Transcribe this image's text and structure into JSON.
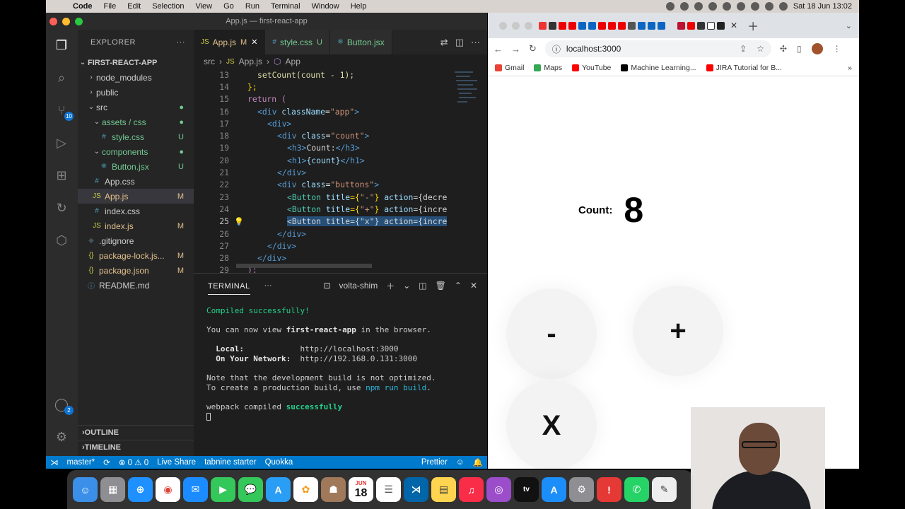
{
  "menubar": {
    "items": [
      "Code",
      "File",
      "Edit",
      "Selection",
      "View",
      "Go",
      "Run",
      "Terminal",
      "Window",
      "Help"
    ],
    "clock": "Sat 18 Jun  13:02"
  },
  "vscode": {
    "window_title": "App.js — first-react-app",
    "explorer": {
      "header": "EXPLORER",
      "project": "FIRST-REACT-APP",
      "items": [
        {
          "label": "node_modules",
          "status": ""
        },
        {
          "label": "public",
          "status": ""
        },
        {
          "label": "src",
          "status": ""
        },
        {
          "label": "assets / css",
          "status": ""
        },
        {
          "label": "style.css",
          "status": "U"
        },
        {
          "label": "components",
          "status": ""
        },
        {
          "label": "Button.jsx",
          "status": "U"
        },
        {
          "label": "App.css",
          "status": ""
        },
        {
          "label": "App.js",
          "status": "M"
        },
        {
          "label": "index.css",
          "status": ""
        },
        {
          "label": "index.js",
          "status": "M"
        },
        {
          "label": ".gitignore",
          "status": ""
        },
        {
          "label": "package-lock.js...",
          "status": "M"
        },
        {
          "label": "package.json",
          "status": "M"
        },
        {
          "label": "README.md",
          "status": ""
        }
      ],
      "outline": "OUTLINE",
      "timeline": "TIMELINE"
    },
    "activity_badges": {
      "scm": "10",
      "accounts": "2"
    },
    "tabs": [
      {
        "label": "App.js",
        "status": "M"
      },
      {
        "label": "style.css",
        "status": "U"
      },
      {
        "label": "Button.jsx",
        "status": ""
      }
    ],
    "breadcrumb": [
      "src",
      "App.js",
      "App"
    ],
    "code": {
      "line_numbers": [
        "13",
        "14",
        "15",
        "16",
        "17",
        "18",
        "19",
        "20",
        "21",
        "22",
        "23",
        "24",
        "25",
        "26",
        "27",
        "28",
        "29"
      ],
      "l13": "setCount(count - 1);",
      "l14": "};",
      "l15": "return (",
      "l16a": "<div ",
      "l16b": "className",
      "l16c": "=",
      "l16d": "\"app\"",
      "l16e": ">",
      "l17": "<div>",
      "l18a": "<div ",
      "l18b": "class",
      "l18c": "=",
      "l18d": "\"count\"",
      "l18e": ">",
      "l19a": "<h3>",
      "l19b": "Count:",
      "l19c": "</h3>",
      "l20a": "<h1>",
      "l20b": "{count}",
      "l20c": "</h1>",
      "l21": "</div>",
      "l22a": "<div ",
      "l22b": "class",
      "l22c": "=",
      "l22d": "\"buttons\"",
      "l22e": ">",
      "l23a": "<Button ",
      "l23b": "title",
      "l23c": "={",
      "l23d": "\"-\"",
      "l23e": "} ",
      "l23f": "action",
      "l23g": "={decre",
      "l24a": "<Button ",
      "l24b": "title",
      "l24c": "={",
      "l24d": "\"+\"",
      "l24e": "} ",
      "l24f": "action",
      "l24g": "={incre",
      "l25": "<Button title={\"x\"} action={incre",
      "l26": "</div>",
      "l27": "</div>",
      "l28": "</div>",
      "l29": ");"
    },
    "terminal": {
      "tab": "TERMINAL",
      "shell": "volta-shim",
      "l1": "Compiled successfully!",
      "l2a": "You can now view ",
      "l2b": "first-react-app",
      "l2c": " in the browser.",
      "l3a": "  Local:            ",
      "l3b": "http://localhost:3000",
      "l4a": "  On Your Network:  ",
      "l4b": "http://192.168.0.131:3000",
      "l5": "Note that the development build is not optimized.",
      "l6a": "To create a production build, use ",
      "l6b": "npm run build",
      "l6c": ".",
      "l7a": "webpack compiled ",
      "l7b": "successfully"
    },
    "statusbar": {
      "branch": "master*",
      "problems": "⊗ 0 ⚠ 0",
      "liveshare": "Live Share",
      "tabnine": "tabnine starter",
      "quokka": "Quokka",
      "prettier": "Prettier"
    }
  },
  "chrome": {
    "url": "localhost:3000",
    "bookmarks": [
      "Gmail",
      "Maps",
      "YouTube",
      "Machine Learning...",
      "JIRA Tutorial for B..."
    ],
    "app": {
      "count_label": "Count:",
      "count_value": "8",
      "buttons": [
        "-",
        "+",
        "X"
      ]
    }
  },
  "dock": {
    "calendar_day": "18",
    "calendar_month": "JUN"
  },
  "colors": {
    "vscode_bg": "#1e1e1e",
    "statusbar": "#007acc",
    "selection": "#264f78"
  }
}
